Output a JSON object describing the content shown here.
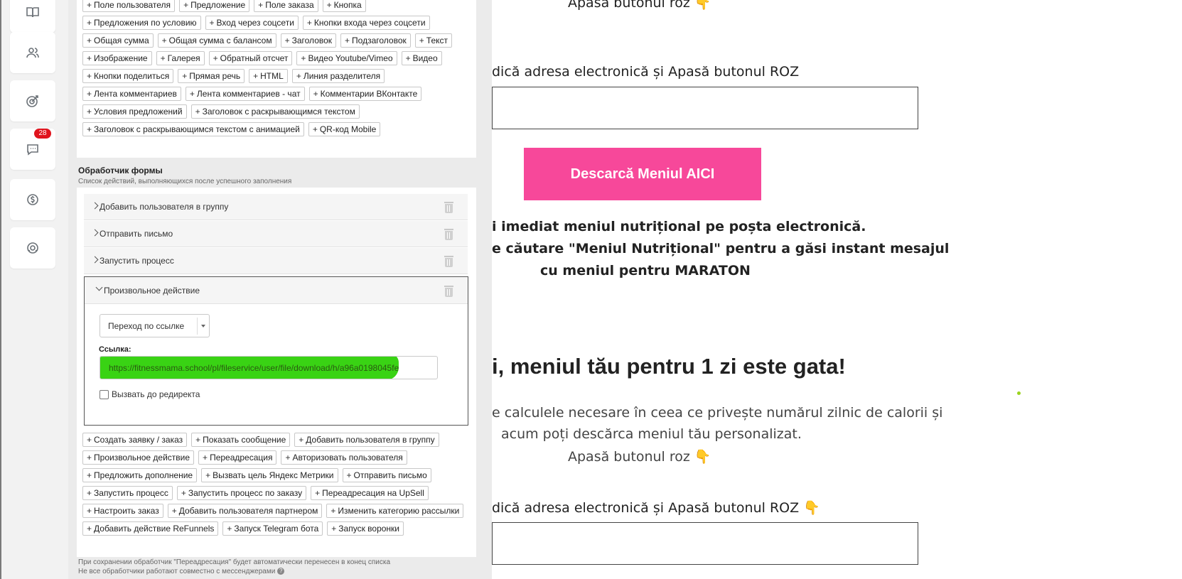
{
  "sidebar": {
    "items": [
      {
        "icon": "book-icon",
        "badge": ""
      },
      {
        "icon": "users-icon",
        "badge": ""
      },
      {
        "icon": "target-icon",
        "badge": ""
      },
      {
        "icon": "chat-icon",
        "badge": "28"
      },
      {
        "icon": "coin-icon",
        "badge": ""
      },
      {
        "icon": "support-icon",
        "badge": ""
      }
    ]
  },
  "blocks": {
    "chips": [
      "Поле пользователя",
      "Предложение",
      "Поле заказа",
      "Кнопка",
      "Предложения по условию",
      "Вход через соцсети",
      "Кнопки входа через соцсети",
      "Общая сумма",
      "Общая сумма с балансом",
      "Заголовок",
      "Подзаголовок",
      "Текст",
      "Изображение",
      "Галерея",
      "Обратный отсчет",
      "Видео Youtube/Vimeo",
      "Видео",
      "Кнопки поделиться",
      "Прямая речь",
      "HTML",
      "Линия разделителя",
      "Лента комментариев",
      "Лента комментариев - чат",
      "Комментарии ВКонтакте",
      "Условия предложений",
      "Заголовок с раскрывающимся текстом",
      "Заголовок с раскрывающимся текстом с анимацией",
      "QR-код Mobile"
    ]
  },
  "form_handler": {
    "title": "Обработчик формы",
    "subtitle": "Список действий, выполняющихся после успешного заполнения",
    "rows": [
      "Добавить пользователя в группу",
      "Отправить письмо",
      "Запустить процесс"
    ],
    "expanded": {
      "title": "Произвольное действие",
      "select_value": "Переход по ссылке",
      "link_label": "Ссылка:",
      "link_value": "https://fitnessmama.school/pl/fileservice/user/file/download/h/a96a0198045fe",
      "checkbox_label": "Вызвать до редиректа"
    },
    "add_chips": [
      "Создать заявку / заказ",
      "Показать сообщение",
      "Добавить пользователя в группу",
      "Произвольное действие",
      "Переадресация",
      "Авторизовать пользователя",
      "Предложить дополнение",
      "Вызвать цель Яндекс Метрики",
      "Отправить письмо",
      "Запустить процесс",
      "Запустить процесс по заказу",
      "Переадресация на UpSell",
      "Настроить заказ",
      "Добавить пользователя партнером",
      "Изменить категорию рассылки",
      "Добавить действие ReFunnels",
      "Запуск Telegram бота",
      "Запуск воронки"
    ],
    "note1": "При сохранении обработчик \"Переадресация\" будет автоматически перенесен в конец списка",
    "note2": "Не все обработчики работают совместно с мессенджерами"
  },
  "preview": {
    "top_text": "Apasă butonul roz 👇",
    "email_label": "dică adresa electronică și Apasă butonul ROZ",
    "button_label": "Descarcă Meniul AICI",
    "bold1": "i imediat meniul nutrițional pe poșta electronică.",
    "bold2": "e căutare \"Meniul Nutrițional\" pentru a găsi instant mesajul",
    "bold3": "cu meniul pentru MARATON",
    "headline": "i, meniul tău pentru 1 zi este gata!",
    "para1": "e calculele necesare în ceea ce privește numărul zilnic de calorii și",
    "para2": "acum poți descărca meniul tău personalizat.",
    "para3": "Apasă butonul roz 👇",
    "email_label2": "dică adresa electronică și Apasă butonul ROZ 👇",
    "colors": {
      "button": "#f7489a",
      "highlight": "#39d314"
    }
  }
}
